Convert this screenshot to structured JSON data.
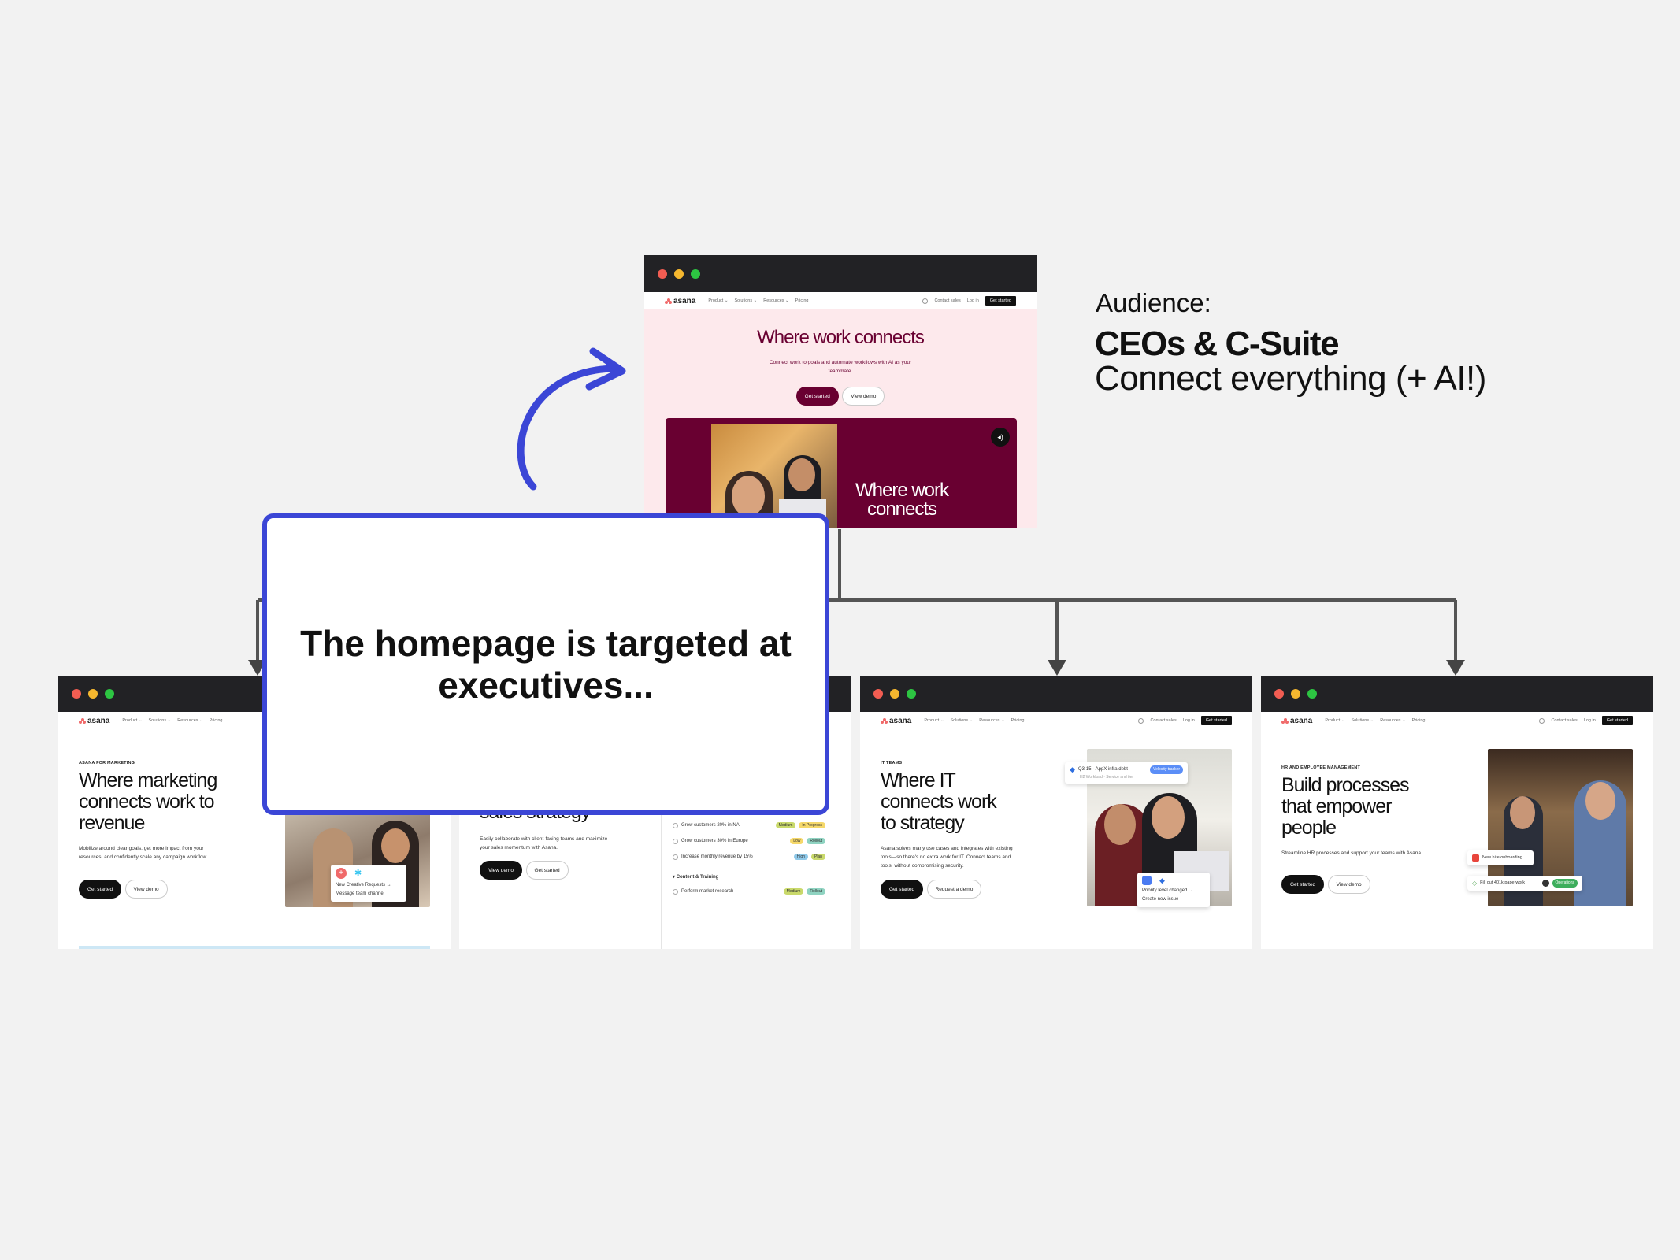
{
  "audience": {
    "label": "Audience:",
    "title": "CEOs & C-Suite",
    "subtitle": "Connect everything (+ AI!)"
  },
  "callout": {
    "text": "The homepage is targeted at executives..."
  },
  "nav": {
    "logo": "asana",
    "product": "Product ⌄",
    "solutions": "Solutions ⌄",
    "resources": "Resources ⌄",
    "pricing": "Pricing",
    "contact": "Contact sales",
    "login": "Log in",
    "cta": "Get started"
  },
  "home": {
    "headline": "Where work connects",
    "subtext": "Connect work to goals and automate workflows with AI as your teammate.",
    "primary_button": "Get started",
    "secondary_button": "View demo",
    "video_headline": "Where work connects",
    "colors": {
      "background": "#fde9ec",
      "accent": "#690031"
    }
  },
  "marketing": {
    "eyebrow": "ASANA FOR MARKETING",
    "headline": "Where marketing connects work to revenue",
    "subtext": "Mobilize around clear goals, get more impact from your resources, and confidently scale any campaign workflow.",
    "primary_button": "Get started",
    "secondary_button": "View demo",
    "chip_line1": "New Creative Requests →",
    "chip_line2": "Message team channel"
  },
  "sales": {
    "headline_fragment": "sales strategy",
    "subtext": "Easily collaborate with client-facing teams and maximize your sales momentum with Asana.",
    "primary_button": "View demo",
    "secondary_button": "Get started",
    "tasks": [
      {
        "label": "Grow customers 20% in NA",
        "tag": "Medium",
        "status": "In Progress",
        "tag_color": "#c9d96b",
        "status_color": "#f5d86a"
      },
      {
        "label": "Grow customers 30% in Europe",
        "tag": "Low",
        "status": "Rollout",
        "tag_color": "#f5d86a",
        "status_color": "#8fd3c1"
      },
      {
        "label": "Increase monthly revenue by 15%",
        "tag": "High",
        "status": "Plan",
        "tag_color": "#8ec8e8",
        "status_color": "#c9d96b"
      }
    ],
    "section_label": "Content & Training",
    "section_task": {
      "label": "Perform market research",
      "tag": "Medium",
      "status": "Rollout",
      "tag_color": "#c9d96b",
      "status_color": "#8fd3c1"
    }
  },
  "it": {
    "eyebrow": "IT TEAMS",
    "headline": "Where IT connects work to strategy",
    "subtext": "Asana solves many use cases and integrates with existing tools—so there's no extra work for IT. Connect teams and tools, without compromising security.",
    "primary_button": "Get started",
    "secondary_button": "Request a demo",
    "chip_top_title": "Q3-15 · AppX infra debt",
    "chip_top_meta": "H2 Workload  ·  Service and tier",
    "chip_top_badge": "Velocity tracker",
    "chip_bottom_line1": "Priority level changed →",
    "chip_bottom_line2": "Create new issue"
  },
  "hr": {
    "eyebrow": "HR AND EMPLOYEE MANAGEMENT",
    "headline": "Build processes that empower people",
    "subtext": "Streamline HR processes and support your teams with Asana.",
    "primary_button": "Get started",
    "secondary_button": "View demo",
    "chip_top": "New hire onboarding",
    "chip_bottom": "Fill out 401k paperwork",
    "chip_badge": "Operations"
  }
}
